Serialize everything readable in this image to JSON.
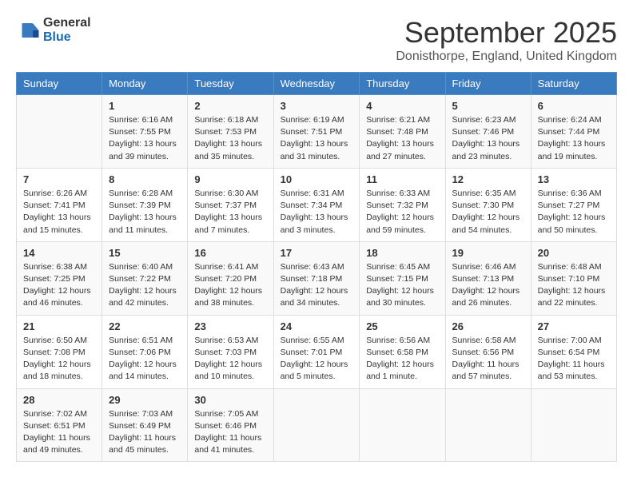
{
  "header": {
    "logo_general": "General",
    "logo_blue": "Blue",
    "month_title": "September 2025",
    "location": "Donisthorpe, England, United Kingdom"
  },
  "days_of_week": [
    "Sunday",
    "Monday",
    "Tuesday",
    "Wednesday",
    "Thursday",
    "Friday",
    "Saturday"
  ],
  "weeks": [
    [
      {
        "day": "",
        "info": ""
      },
      {
        "day": "1",
        "info": "Sunrise: 6:16 AM\nSunset: 7:55 PM\nDaylight: 13 hours\nand 39 minutes."
      },
      {
        "day": "2",
        "info": "Sunrise: 6:18 AM\nSunset: 7:53 PM\nDaylight: 13 hours\nand 35 minutes."
      },
      {
        "day": "3",
        "info": "Sunrise: 6:19 AM\nSunset: 7:51 PM\nDaylight: 13 hours\nand 31 minutes."
      },
      {
        "day": "4",
        "info": "Sunrise: 6:21 AM\nSunset: 7:48 PM\nDaylight: 13 hours\nand 27 minutes."
      },
      {
        "day": "5",
        "info": "Sunrise: 6:23 AM\nSunset: 7:46 PM\nDaylight: 13 hours\nand 23 minutes."
      },
      {
        "day": "6",
        "info": "Sunrise: 6:24 AM\nSunset: 7:44 PM\nDaylight: 13 hours\nand 19 minutes."
      }
    ],
    [
      {
        "day": "7",
        "info": "Sunrise: 6:26 AM\nSunset: 7:41 PM\nDaylight: 13 hours\nand 15 minutes."
      },
      {
        "day": "8",
        "info": "Sunrise: 6:28 AM\nSunset: 7:39 PM\nDaylight: 13 hours\nand 11 minutes."
      },
      {
        "day": "9",
        "info": "Sunrise: 6:30 AM\nSunset: 7:37 PM\nDaylight: 13 hours\nand 7 minutes."
      },
      {
        "day": "10",
        "info": "Sunrise: 6:31 AM\nSunset: 7:34 PM\nDaylight: 13 hours\nand 3 minutes."
      },
      {
        "day": "11",
        "info": "Sunrise: 6:33 AM\nSunset: 7:32 PM\nDaylight: 12 hours\nand 59 minutes."
      },
      {
        "day": "12",
        "info": "Sunrise: 6:35 AM\nSunset: 7:30 PM\nDaylight: 12 hours\nand 54 minutes."
      },
      {
        "day": "13",
        "info": "Sunrise: 6:36 AM\nSunset: 7:27 PM\nDaylight: 12 hours\nand 50 minutes."
      }
    ],
    [
      {
        "day": "14",
        "info": "Sunrise: 6:38 AM\nSunset: 7:25 PM\nDaylight: 12 hours\nand 46 minutes."
      },
      {
        "day": "15",
        "info": "Sunrise: 6:40 AM\nSunset: 7:22 PM\nDaylight: 12 hours\nand 42 minutes."
      },
      {
        "day": "16",
        "info": "Sunrise: 6:41 AM\nSunset: 7:20 PM\nDaylight: 12 hours\nand 38 minutes."
      },
      {
        "day": "17",
        "info": "Sunrise: 6:43 AM\nSunset: 7:18 PM\nDaylight: 12 hours\nand 34 minutes."
      },
      {
        "day": "18",
        "info": "Sunrise: 6:45 AM\nSunset: 7:15 PM\nDaylight: 12 hours\nand 30 minutes."
      },
      {
        "day": "19",
        "info": "Sunrise: 6:46 AM\nSunset: 7:13 PM\nDaylight: 12 hours\nand 26 minutes."
      },
      {
        "day": "20",
        "info": "Sunrise: 6:48 AM\nSunset: 7:10 PM\nDaylight: 12 hours\nand 22 minutes."
      }
    ],
    [
      {
        "day": "21",
        "info": "Sunrise: 6:50 AM\nSunset: 7:08 PM\nDaylight: 12 hours\nand 18 minutes."
      },
      {
        "day": "22",
        "info": "Sunrise: 6:51 AM\nSunset: 7:06 PM\nDaylight: 12 hours\nand 14 minutes."
      },
      {
        "day": "23",
        "info": "Sunrise: 6:53 AM\nSunset: 7:03 PM\nDaylight: 12 hours\nand 10 minutes."
      },
      {
        "day": "24",
        "info": "Sunrise: 6:55 AM\nSunset: 7:01 PM\nDaylight: 12 hours\nand 5 minutes."
      },
      {
        "day": "25",
        "info": "Sunrise: 6:56 AM\nSunset: 6:58 PM\nDaylight: 12 hours\nand 1 minute."
      },
      {
        "day": "26",
        "info": "Sunrise: 6:58 AM\nSunset: 6:56 PM\nDaylight: 11 hours\nand 57 minutes."
      },
      {
        "day": "27",
        "info": "Sunrise: 7:00 AM\nSunset: 6:54 PM\nDaylight: 11 hours\nand 53 minutes."
      }
    ],
    [
      {
        "day": "28",
        "info": "Sunrise: 7:02 AM\nSunset: 6:51 PM\nDaylight: 11 hours\nand 49 minutes."
      },
      {
        "day": "29",
        "info": "Sunrise: 7:03 AM\nSunset: 6:49 PM\nDaylight: 11 hours\nand 45 minutes."
      },
      {
        "day": "30",
        "info": "Sunrise: 7:05 AM\nSunset: 6:46 PM\nDaylight: 11 hours\nand 41 minutes."
      },
      {
        "day": "",
        "info": ""
      },
      {
        "day": "",
        "info": ""
      },
      {
        "day": "",
        "info": ""
      },
      {
        "day": "",
        "info": ""
      }
    ]
  ]
}
